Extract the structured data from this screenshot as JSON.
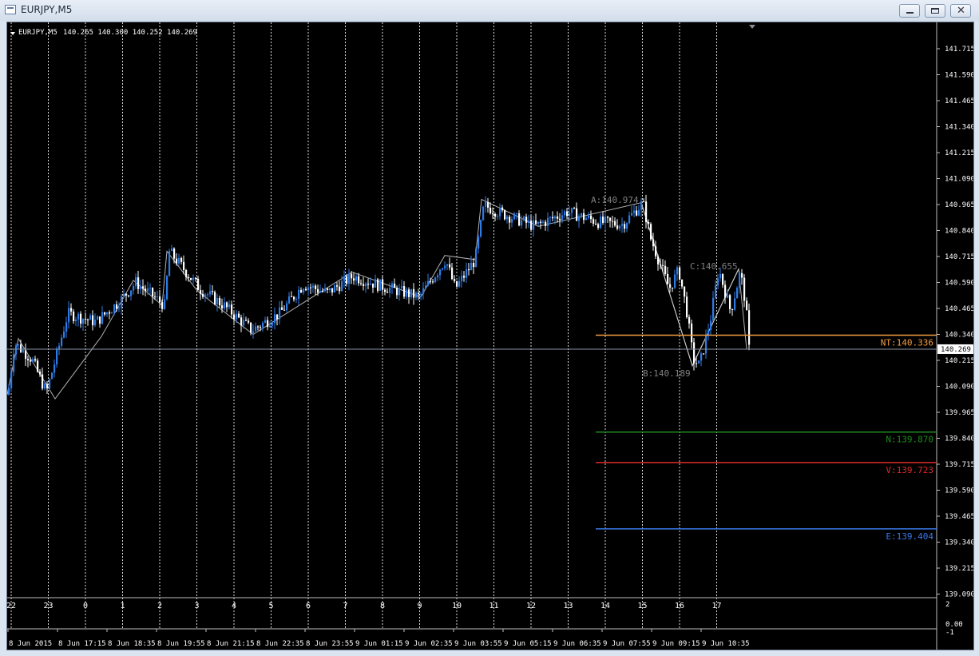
{
  "window": {
    "title": "EURJPY,M5",
    "buttons": {
      "minimize": "minimize",
      "maximize": "maximize",
      "close": "✕"
    }
  },
  "header": {
    "symbol_label": "EURJPY,M5",
    "ohlc": "140.265 140.300 140.252 140.269"
  },
  "price_axis": {
    "ticks": [
      "141.715",
      "141.590",
      "141.465",
      "141.340",
      "141.215",
      "141.090",
      "140.965",
      "140.840",
      "140.715",
      "140.590",
      "140.465",
      "140.340",
      "140.215",
      "140.090",
      "139.965",
      "139.840",
      "139.715",
      "139.590",
      "139.465",
      "139.340",
      "139.215",
      "139.090"
    ],
    "current_price_label": "140.269"
  },
  "hour_labels": [
    "22",
    "23",
    "0",
    "1",
    "2",
    "3",
    "4",
    "5",
    "6",
    "7",
    "8",
    "9",
    "10",
    "11",
    "12",
    "13",
    "14",
    "15",
    "16",
    "17"
  ],
  "time_axis": [
    "8 Jun 2015",
    "8 Jun 17:15",
    "8 Jun 18:35",
    "8 Jun 19:55",
    "8 Jun 21:15",
    "8 Jun 22:35",
    "8 Jun 23:55",
    "9 Jun 01:15",
    "9 Jun 02:35",
    "9 Jun 03:55",
    "9 Jun 05:15",
    "9 Jun 06:35",
    "9 Jun 07:55",
    "9 Jun 09:15",
    "9 Jun 10:35"
  ],
  "indicator_axis": {
    "top": "2",
    "mid": "0.00",
    "bottom": "-1"
  },
  "levels": [
    {
      "label": "NT:140.336",
      "color": "#f39c3f"
    },
    {
      "label": "N:139.870",
      "color": "#1f8a1f"
    },
    {
      "label": "V:139.723",
      "color": "#e02a2a"
    },
    {
      "label": "E:139.404",
      "color": "#3a78e8"
    }
  ],
  "pattern_labels": {
    "A": "A:140.974",
    "B": "B:140.189",
    "C": "C:140.655"
  },
  "colors": {
    "background": "#000000",
    "bull_candle": "#2f7be6",
    "bear_candle": "#ffffff",
    "grid": "#ffffff",
    "current_line": "#8a95a5",
    "zigzag": "#b0b0b0"
  },
  "chart_data": {
    "type": "candlestick",
    "symbol": "EURJPY",
    "timeframe": "M5",
    "y_range": [
      139.09,
      141.76
    ],
    "last_price": 140.269,
    "key_points": [
      {
        "x": "22",
        "price": 140.3
      },
      {
        "x": "22",
        "price": 140.05
      },
      {
        "x": "2",
        "price": 140.74
      },
      {
        "x": "4",
        "price": 140.36
      },
      {
        "x": "10",
        "price": 140.7
      },
      {
        "x": "10",
        "price": 140.96
      },
      {
        "x": "15",
        "price": 140.974
      },
      {
        "x": "16",
        "price": 140.189
      },
      {
        "x": "17",
        "price": 140.655
      },
      {
        "x": "17",
        "price": 140.269
      }
    ]
  }
}
